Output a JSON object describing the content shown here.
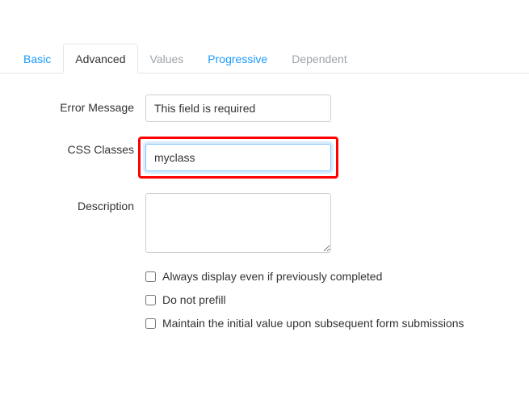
{
  "tabs": {
    "items": [
      {
        "label": "Basic",
        "style": "link"
      },
      {
        "label": "Advanced",
        "style": "active"
      },
      {
        "label": "Values",
        "style": "muted"
      },
      {
        "label": "Progressive",
        "style": "link"
      },
      {
        "label": "Dependent",
        "style": "muted"
      }
    ]
  },
  "form": {
    "errorMessage": {
      "label": "Error Message",
      "value": "This field is required"
    },
    "cssClasses": {
      "label": "CSS Classes",
      "value": "myclass"
    },
    "description": {
      "label": "Description",
      "value": ""
    },
    "checks": {
      "alwaysDisplay": {
        "label": "Always display even if previously completed",
        "checked": false
      },
      "doNotPrefill": {
        "label": "Do not prefill",
        "checked": false
      },
      "maintainInitial": {
        "label": "Maintain the initial value upon subsequent form submissions",
        "checked": false
      }
    }
  },
  "highlight": {
    "field": "cssClasses",
    "color": "#ff0000"
  }
}
